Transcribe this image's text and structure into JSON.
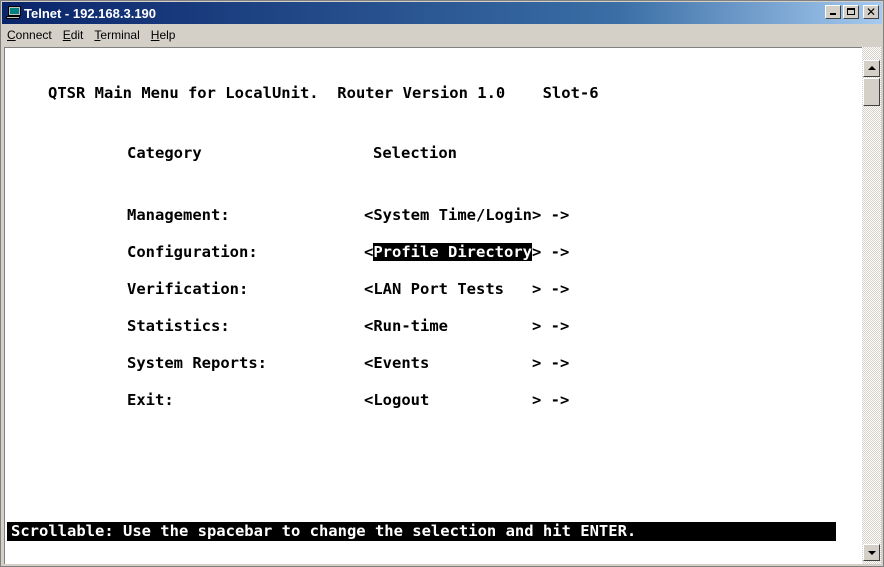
{
  "window": {
    "title": "Telnet - 192.168.3.190",
    "app_icon": "telnet-computer-icon"
  },
  "menu": [
    {
      "label": "Connect",
      "accel": "C",
      "rest": "onnect"
    },
    {
      "label": "Edit",
      "accel": "E",
      "rest": "dit"
    },
    {
      "label": "Terminal",
      "accel": "T",
      "rest": "erminal"
    },
    {
      "label": "Help",
      "accel": "H",
      "rest": "elp"
    }
  ],
  "terminal": {
    "header": "QTSR Main Menu for LocalUnit.  Router Version 1.0    Slot-6",
    "col_category": "Category",
    "col_selection": "Selection",
    "rows": [
      {
        "category": "Management:",
        "open": "<",
        "selection": "System Time/Login",
        "close": "> ->",
        "selected": false
      },
      {
        "category": "Configuration:",
        "open": "<",
        "selection": "Profile Directory",
        "close": "> ->",
        "selected": true
      },
      {
        "category": "Verification:",
        "open": "<",
        "selection": "LAN Port Tests   ",
        "close": "> ->",
        "selected": false
      },
      {
        "category": "Statistics:",
        "open": "<",
        "selection": "Run-time         ",
        "close": "> ->",
        "selected": false
      },
      {
        "category": "System Reports:",
        "open": "<",
        "selection": "Events           ",
        "close": "> ->",
        "selected": false
      },
      {
        "category": "Exit:",
        "open": "<",
        "selection": "Logout           ",
        "close": "> ->",
        "selected": false
      }
    ],
    "status": "Scrollable: Use the spacebar to change the selection and hit ENTER."
  },
  "colors": {
    "titlebar": "#0a246a",
    "highlight_bg": "#000000",
    "highlight_fg": "#ffffff"
  }
}
